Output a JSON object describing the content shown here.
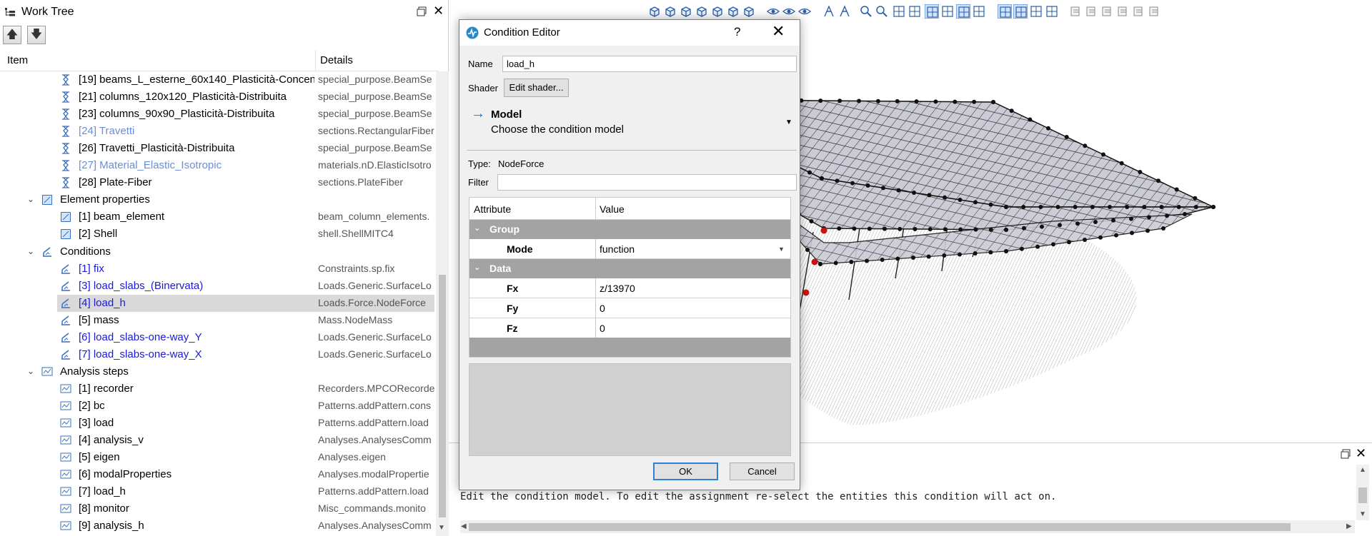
{
  "worktree": {
    "title": "Work Tree",
    "float_icon": "float-window-icon",
    "close_label": "✕",
    "up_label": "🡅",
    "down_label": "🡇",
    "col_item": "Item",
    "col_details": "Details",
    "rows": [
      {
        "label": "[19] beams_L_esterne_60x140_Plasticità-Concen...",
        "details": "special_purpose.BeamSe",
        "icon": "section-icon",
        "color": "normal"
      },
      {
        "label": "[21] columns_120x120_Plasticità-Distribuita",
        "details": "special_purpose.BeamSe",
        "icon": "section-icon",
        "color": "normal"
      },
      {
        "label": "[23] columns_90x90_Plasticità-Distribuita",
        "details": "special_purpose.BeamSe",
        "icon": "section-icon",
        "color": "normal"
      },
      {
        "label": "[24] Travetti",
        "details": "sections.RectangularFiber",
        "icon": "section-icon",
        "color": "light"
      },
      {
        "label": "[26] Travetti_Plasticità-Distribuita",
        "details": "special_purpose.BeamSe",
        "icon": "section-icon",
        "color": "normal"
      },
      {
        "label": "[27] Material_Elastic_Isotropic",
        "details": "materials.nD.ElasticIsotro",
        "icon": "section-icon",
        "color": "light"
      },
      {
        "label": "[28] Plate-Fiber",
        "details": "sections.PlateFiber",
        "icon": "section-icon",
        "color": "normal"
      },
      {
        "label": "Element properties",
        "details": "",
        "icon": "element-properties-icon",
        "color": "normal",
        "group": true
      },
      {
        "label": "[1] beam_element",
        "details": "beam_column_elements.",
        "icon": "element-icon",
        "color": "normal"
      },
      {
        "label": "[2] Shell",
        "details": "shell.ShellMITC4",
        "icon": "element-icon",
        "color": "normal"
      },
      {
        "label": "Conditions",
        "details": "",
        "icon": "conditions-icon",
        "color": "normal",
        "group": true
      },
      {
        "label": "[1] fix",
        "details": "Constraints.sp.fix",
        "icon": "condition-icon",
        "color": "blue"
      },
      {
        "label": "[3] load_slabs_(Binervata)",
        "details": "Loads.Generic.SurfaceLo",
        "icon": "condition-icon",
        "color": "blue"
      },
      {
        "label": "[4] load_h",
        "details": "Loads.Force.NodeForce",
        "icon": "condition-icon",
        "color": "blue",
        "selected": true
      },
      {
        "label": "[5] mass",
        "details": "Mass.NodeMass",
        "icon": "condition-icon",
        "color": "normal"
      },
      {
        "label": "[6] load_slabs-one-way_Y",
        "details": "Loads.Generic.SurfaceLo",
        "icon": "condition-icon",
        "color": "blue"
      },
      {
        "label": "[7] load_slabs-one-way_X",
        "details": "Loads.Generic.SurfaceLo",
        "icon": "condition-icon",
        "color": "blue"
      },
      {
        "label": "Analysis steps",
        "details": "",
        "icon": "analysis-steps-icon",
        "color": "normal",
        "group": true
      },
      {
        "label": "[1] recorder",
        "details": "Recorders.MPCORecorde",
        "icon": "analysis-step-icon",
        "color": "normal"
      },
      {
        "label": "[2] bc",
        "details": "Patterns.addPattern.cons",
        "icon": "analysis-step-icon",
        "color": "normal"
      },
      {
        "label": "[3] load",
        "details": "Patterns.addPattern.load",
        "icon": "analysis-step-icon",
        "color": "normal"
      },
      {
        "label": "[4] analysis_v",
        "details": "Analyses.AnalysesComm",
        "icon": "analysis-step-icon",
        "color": "normal"
      },
      {
        "label": "[5] eigen",
        "details": "Analyses.eigen",
        "icon": "analysis-step-icon",
        "color": "normal"
      },
      {
        "label": "[6] modalProperties",
        "details": "Analyses.modalPropertie",
        "icon": "analysis-step-icon",
        "color": "normal"
      },
      {
        "label": "[7] load_h",
        "details": "Patterns.addPattern.load",
        "icon": "analysis-step-icon",
        "color": "normal"
      },
      {
        "label": "[8] monitor",
        "details": "Misc_commands.monito",
        "icon": "analysis-step-icon",
        "color": "normal"
      },
      {
        "label": "[9] analysis_h",
        "details": "Analyses.AnalysesComm",
        "icon": "analysis-step-icon",
        "color": "normal"
      }
    ]
  },
  "dialog": {
    "title": "Condition Editor",
    "help_label": "?",
    "close_label": "✕",
    "name_label": "Name",
    "name_value": "load_h",
    "shader_label": "Shader",
    "shader_button": "Edit shader...",
    "model_title": "Model",
    "model_subtitle": "Choose the condition model",
    "type_label": "Type:",
    "type_value": "NodeForce",
    "filter_label": "Filter",
    "filter_value": "",
    "grid": {
      "col_attribute": "Attribute",
      "col_value": "Value",
      "group1": "Group",
      "mode_attr": "Mode",
      "mode_value": "function",
      "group2": "Data",
      "fx_attr": "Fx",
      "fx_value": "z/13970",
      "fy_attr": "Fy",
      "fy_value": "0",
      "fz_attr": "Fz",
      "fz_value": "0"
    },
    "ok_label": "OK",
    "cancel_label": "Cancel"
  },
  "output": {
    "message": "Edit the condition model. To edit the assignment re-select the entities this condition will act on.",
    "close_label": "✕"
  },
  "colors": {
    "accent": "#2f7fd6",
    "link_blue": "#1a1ad4",
    "light_blue": "#6a8fd8",
    "grid_group_bg": "#a3a3a3",
    "node_red": "#cc1111"
  }
}
